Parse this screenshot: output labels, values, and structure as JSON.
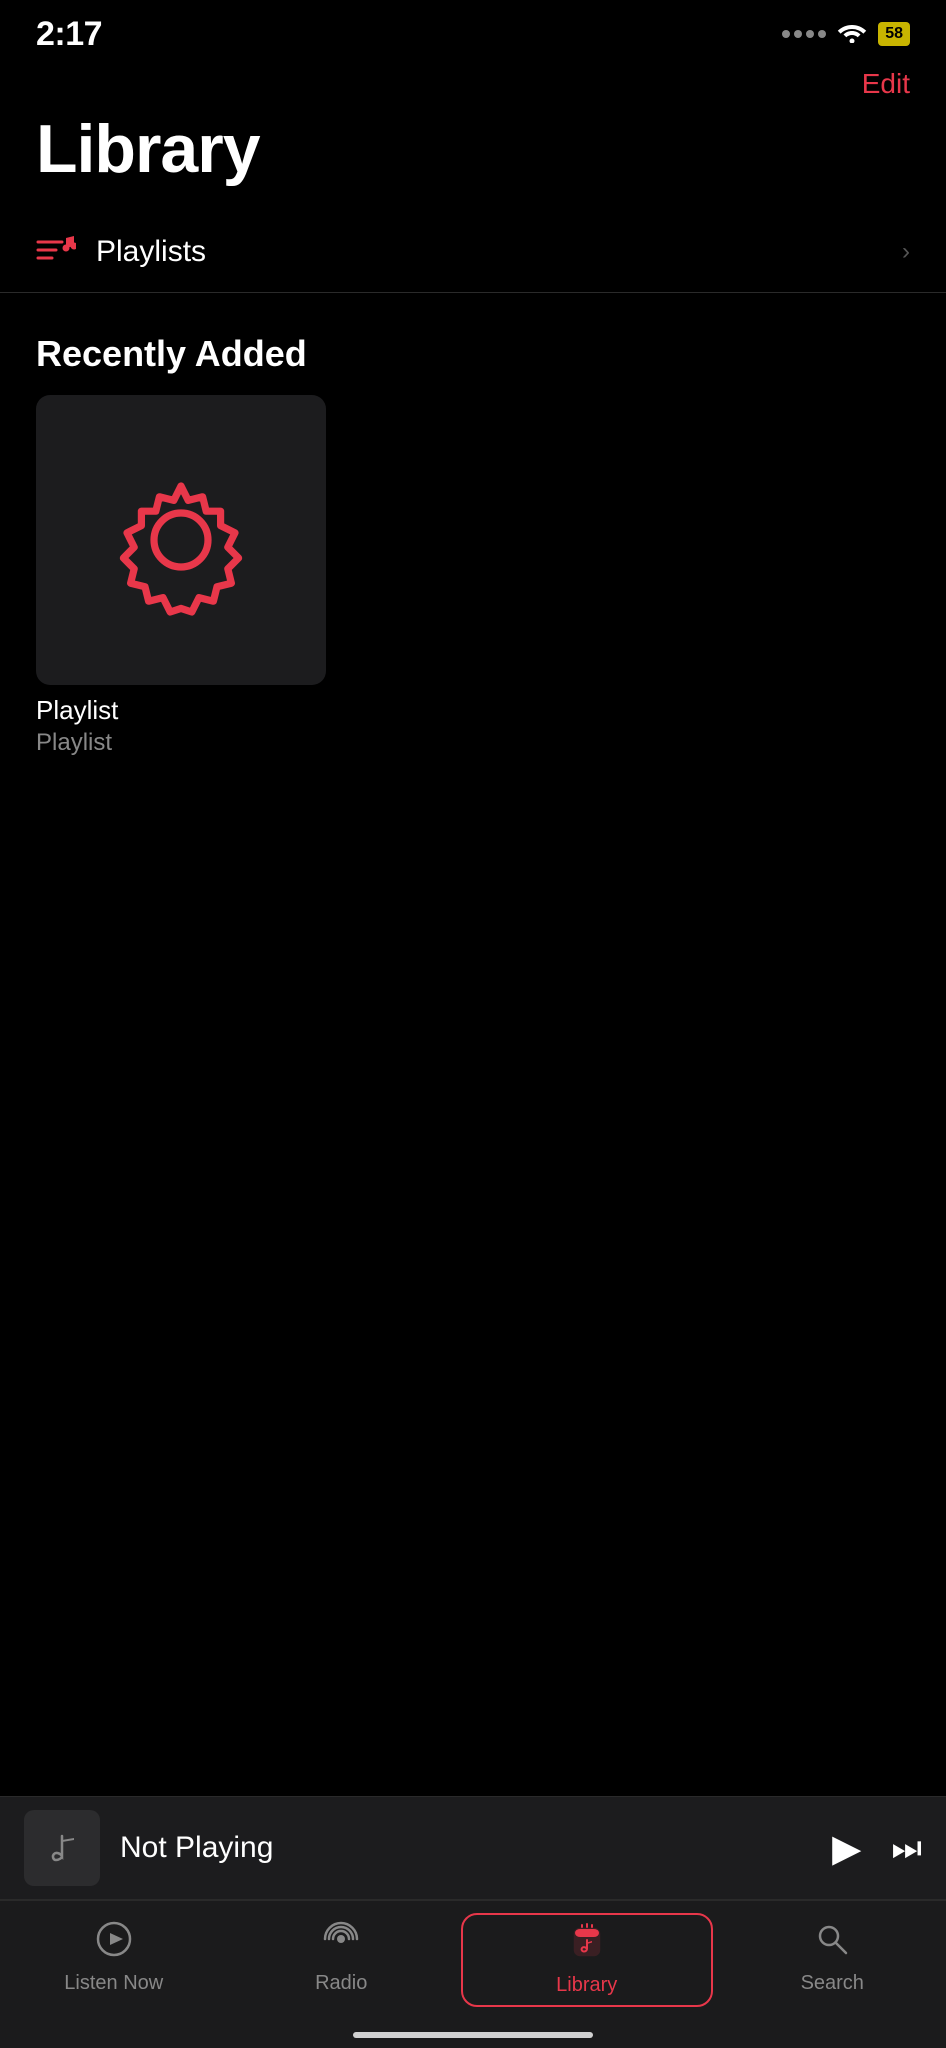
{
  "statusBar": {
    "time": "2:17",
    "battery": "58"
  },
  "header": {
    "editLabel": "Edit"
  },
  "pageTitle": "Library",
  "libraryItems": [
    {
      "id": "playlists",
      "label": "Playlists",
      "icon": "playlist-icon"
    }
  ],
  "recentlyAdded": {
    "sectionTitle": "Recently Added",
    "items": [
      {
        "id": "playlist-1",
        "title": "Playlist",
        "subtitle": "Playlist",
        "hasGearIcon": true
      }
    ]
  },
  "miniPlayer": {
    "title": "Not Playing"
  },
  "tabBar": {
    "tabs": [
      {
        "id": "listen-now",
        "label": "Listen Now",
        "icon": "play-circle"
      },
      {
        "id": "radio",
        "label": "Radio",
        "icon": "radio-waves"
      },
      {
        "id": "library",
        "label": "Library",
        "icon": "library-music",
        "active": true
      },
      {
        "id": "search",
        "label": "Search",
        "icon": "magnifier"
      }
    ]
  }
}
